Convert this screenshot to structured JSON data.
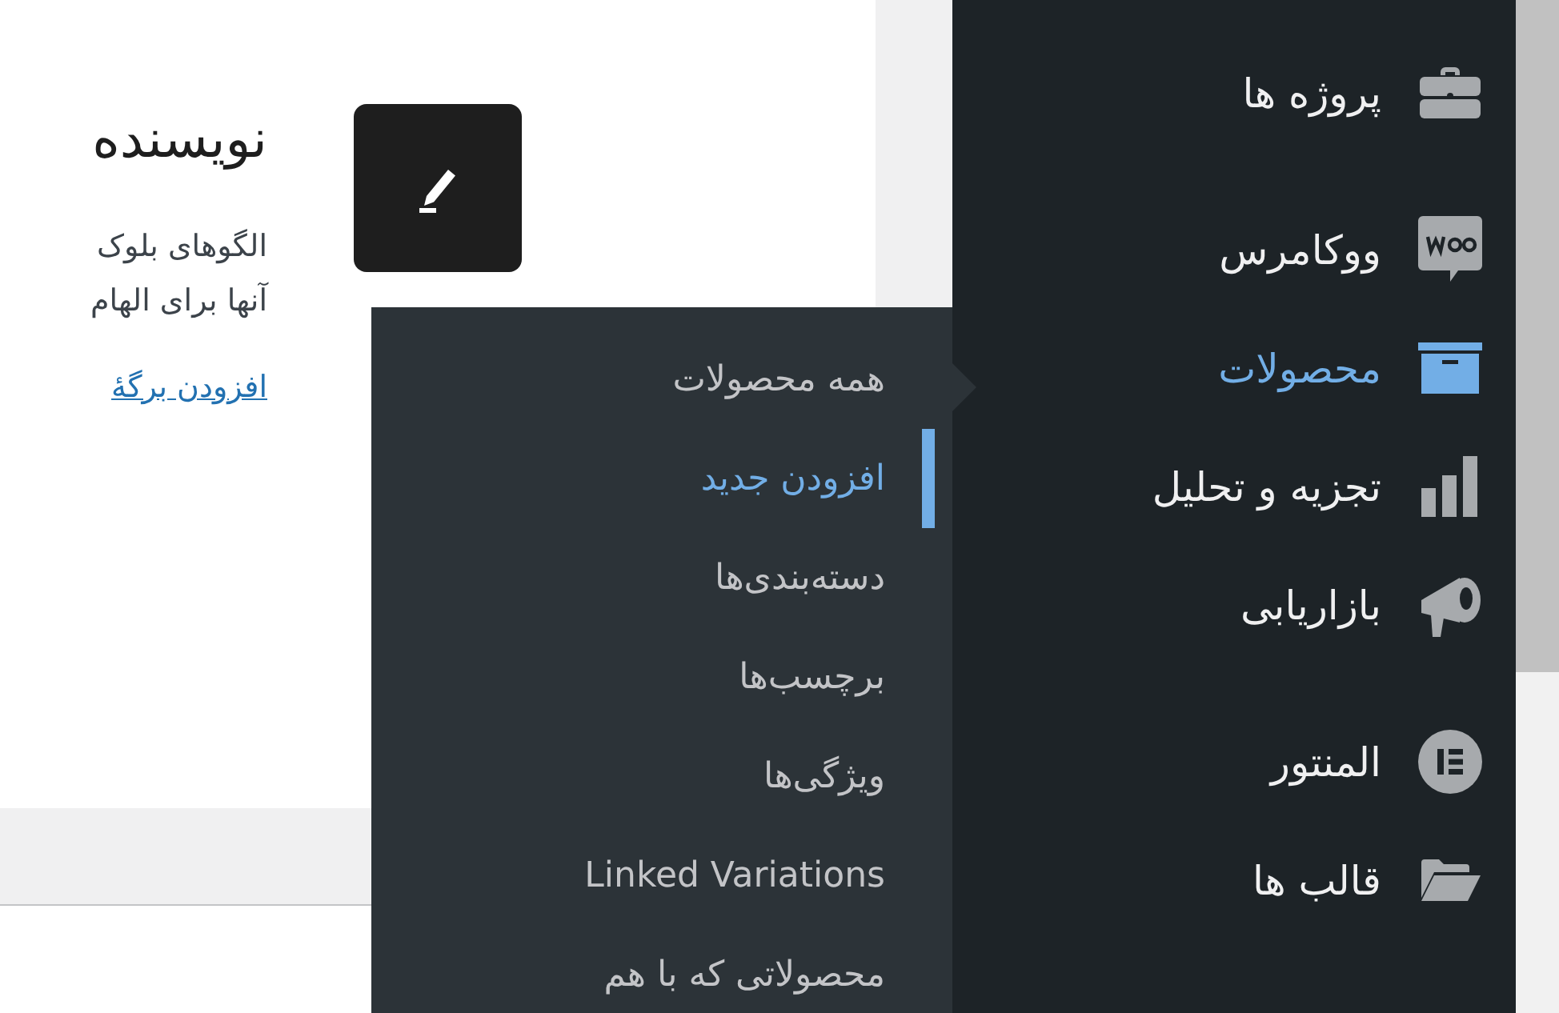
{
  "content": {
    "heading": "نویسنده",
    "paragraph_lines": [
      "الگوهای بلوک",
      "آنها برای الهام"
    ],
    "link": "افزودن برگهٔ"
  },
  "submenu": {
    "items": [
      {
        "label": "همه محصولات",
        "selected": false
      },
      {
        "label": "افزودن جدید",
        "selected": true
      },
      {
        "label": "دسته‌بندی‌ها",
        "selected": false
      },
      {
        "label": "برچسب‌ها",
        "selected": false
      },
      {
        "label": "ویژگی‌ها",
        "selected": false
      },
      {
        "label": "Linked Variations",
        "selected": false
      },
      {
        "label": "محصولاتی که با هم",
        "selected": false
      }
    ]
  },
  "sidebar": {
    "items": [
      {
        "label": "پروژه ها",
        "kind": "briefcase",
        "selected": false
      },
      {
        "kind": "separator"
      },
      {
        "label": "ووکامرس",
        "kind": "woo",
        "selected": false
      },
      {
        "label": "محصولات",
        "kind": "box",
        "selected": true
      },
      {
        "label": "تجزیه و تحلیل",
        "kind": "chart",
        "selected": false
      },
      {
        "label": "بازاریابی",
        "kind": "megaphone",
        "selected": false
      },
      {
        "kind": "separator"
      },
      {
        "label": "المنتور",
        "kind": "elementor",
        "selected": false
      },
      {
        "label": "قالب ها",
        "kind": "folder",
        "selected": false
      }
    ]
  }
}
